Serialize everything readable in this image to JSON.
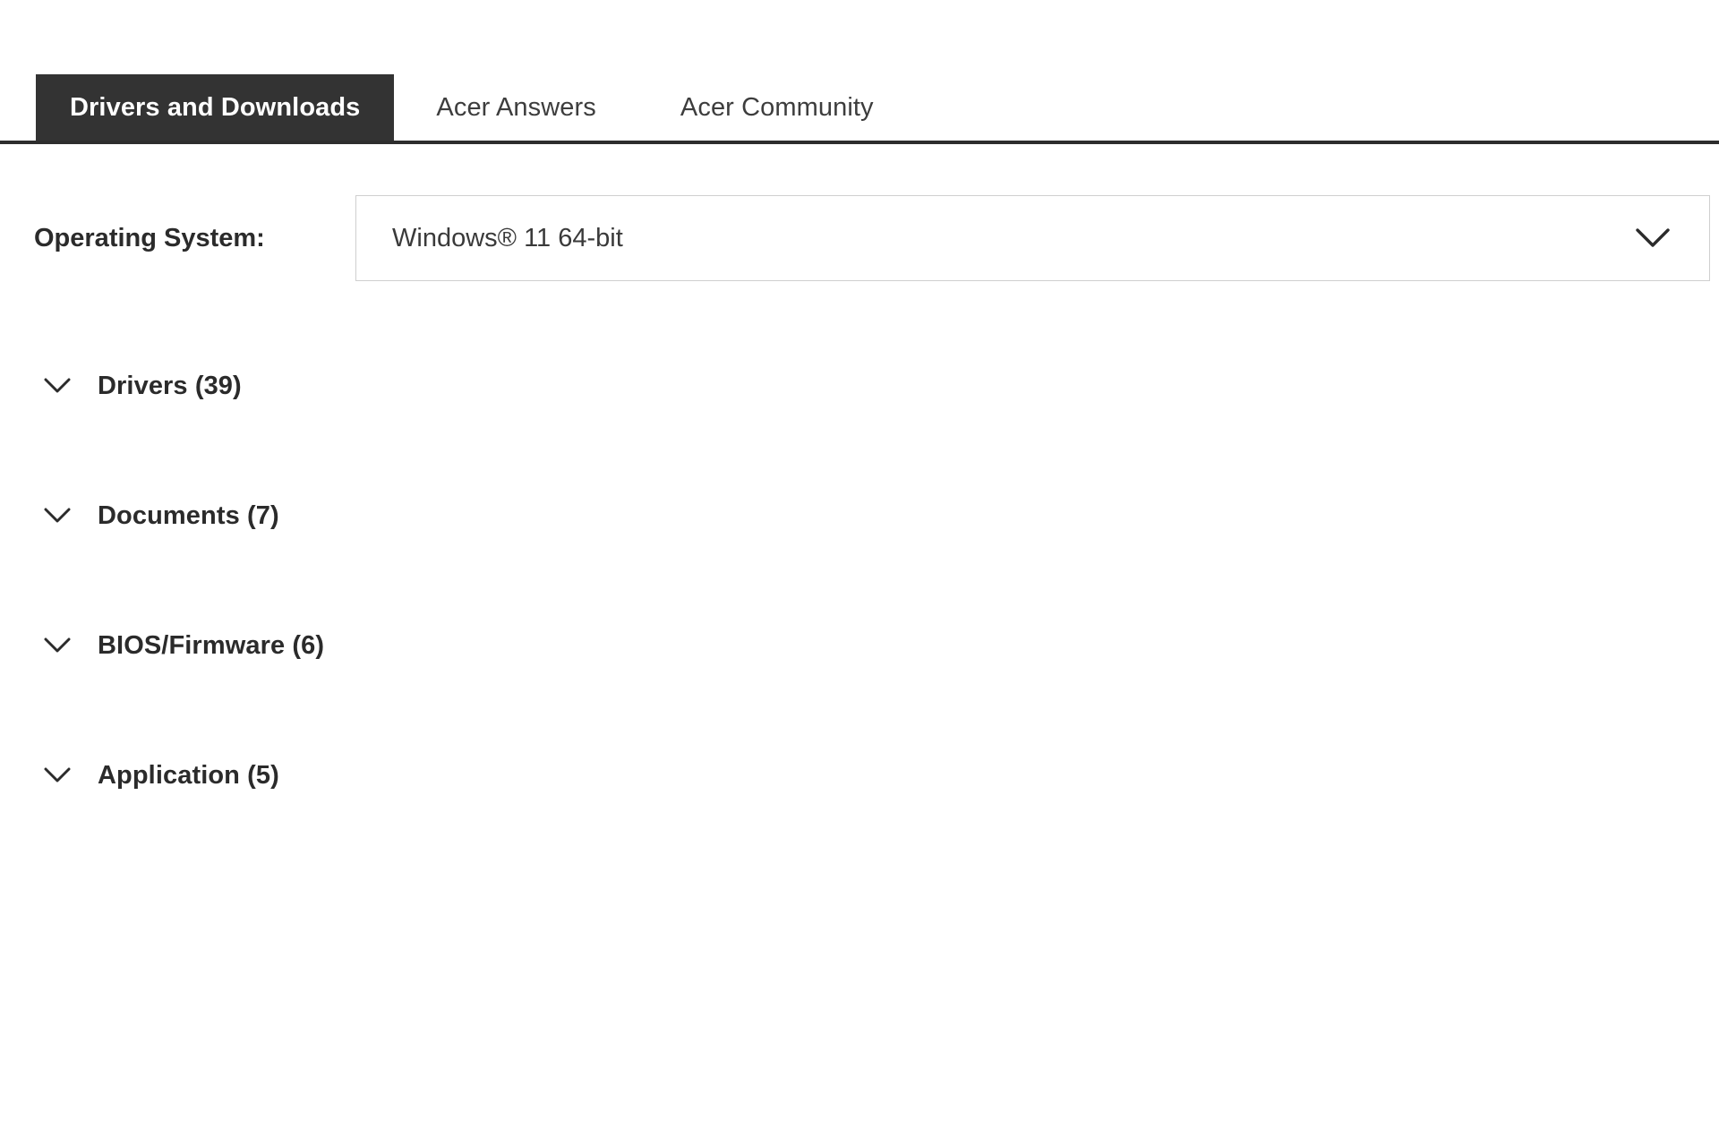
{
  "tabs": [
    {
      "label": "Drivers and Downloads",
      "active": true
    },
    {
      "label": "Acer Answers",
      "active": false
    },
    {
      "label": "Acer Community",
      "active": false
    }
  ],
  "os_selector": {
    "label": "Operating System:",
    "selected_value": "Windows® 11 64-bit",
    "chevron_icon": "chevron-down-icon"
  },
  "sections": [
    {
      "label": "Drivers (39)",
      "name": "drivers",
      "chevron_icon": "chevron-down-icon"
    },
    {
      "label": "Documents (7)",
      "name": "documents",
      "chevron_icon": "chevron-down-icon"
    },
    {
      "label": "BIOS/Firmware (6)",
      "name": "bios-firmware",
      "chevron_icon": "chevron-down-icon"
    },
    {
      "label": "Application (5)",
      "name": "application",
      "chevron_icon": "chevron-down-icon"
    }
  ],
  "colors": {
    "active_tab_bg": "#333333",
    "active_tab_text": "#ffffff",
    "inactive_tab_text": "#3d3d3d",
    "tabbar_border": "#2d2d2d",
    "select_border": "#cfcfcf",
    "body_text": "#2b2b2b",
    "page_bg": "#ffffff"
  }
}
